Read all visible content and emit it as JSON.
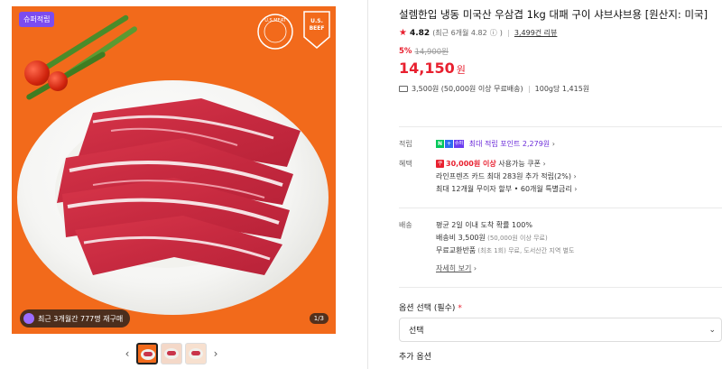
{
  "gallery": {
    "badge_top": "슈퍼적립",
    "logo_circle_text": "U.S.MEAT",
    "logo_shield_text": "U.S. BEEF",
    "badge_bottom": "최근 3개월간 777명 재구매",
    "counter": "1/3",
    "thumbnails_count": 3,
    "prev_icon": "chevron-left-icon",
    "next_icon": "chevron-right-icon"
  },
  "product": {
    "title": "설렘한입 냉동 미국산 우삼겹 1kg 대패 구이 샤브샤브용 [원산지: 미국]",
    "rating_score": "4.82",
    "rating_recent": "(최근 6개월 4.82",
    "rating_info_icon": "ⓘ",
    "rating_recent_close": ")",
    "reviews_link": "3,499건 리뷰",
    "discount": "5%",
    "original_price": "14,900원",
    "price": "14,150",
    "price_unit": "원",
    "shipping": "3,500원 (50,000원 이상 무료배송)",
    "unit_price": "100g당 1,415원"
  },
  "points": {
    "label": "적립",
    "badge_n": "N",
    "badge_plus": "+",
    "badge_m": "슈퍼",
    "text": "최대 적립 포인트 2,279원"
  },
  "benefits": {
    "label": "혜택",
    "coupon_icon": "쿠",
    "coupon_amount": "30,000원 이상",
    "coupon_text": " 사용가능 쿠폰",
    "card": "라인프렌즈 카드 최대 283원 추가 적립(2%)",
    "installment": "최대 12개월 무이자 할부 • 60개월 특별금리"
  },
  "delivery": {
    "label": "배송",
    "line1": "평균 2일 이내 도착 확률 100%",
    "line2_main": "배송비 3,500원",
    "line2_note": " (50,000원 이상 무료)",
    "line3_main": "무료교환반품",
    "line3_note": " (최초 1회) 무료, 도서산간 지역 별도",
    "more_link": "자세히 보기"
  },
  "options": {
    "label": "옵션 선택 (필수)",
    "required_mark": "*",
    "select_value": "선택",
    "add_label": "추가 옵션"
  },
  "colors": {
    "accent_red": "#e8202f",
    "gallery_bg": "#f26a1b",
    "points_purple": "#6b2bd9"
  }
}
